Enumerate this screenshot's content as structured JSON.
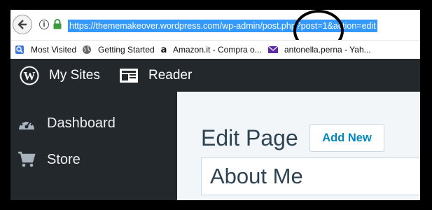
{
  "browser": {
    "url": "https://thememakeover.wordpress.com/wp-admin/post.php?post=1&action=edit",
    "bookmarks": [
      {
        "label": "Most Visited",
        "icon": "most-visited-icon"
      },
      {
        "label": "Getting Started",
        "icon": "globe-icon"
      },
      {
        "label": "Amazon.it - Compra o...",
        "icon": "amazon-icon"
      },
      {
        "label": "antonella.perna - Yah...",
        "icon": "yahoo-mail-icon"
      }
    ]
  },
  "masterbar": {
    "my_sites": "My Sites",
    "reader": "Reader"
  },
  "sidebar": {
    "items": [
      {
        "label": "Dashboard",
        "icon": "dashboard-icon"
      },
      {
        "label": "Store",
        "icon": "cart-icon"
      }
    ]
  },
  "main": {
    "heading": "Edit Page",
    "add_new": "Add New",
    "title_value": "About Me"
  },
  "colors": {
    "masterbar": "#23282d",
    "url_highlight": "#3399ff",
    "accent": "#0087be"
  }
}
